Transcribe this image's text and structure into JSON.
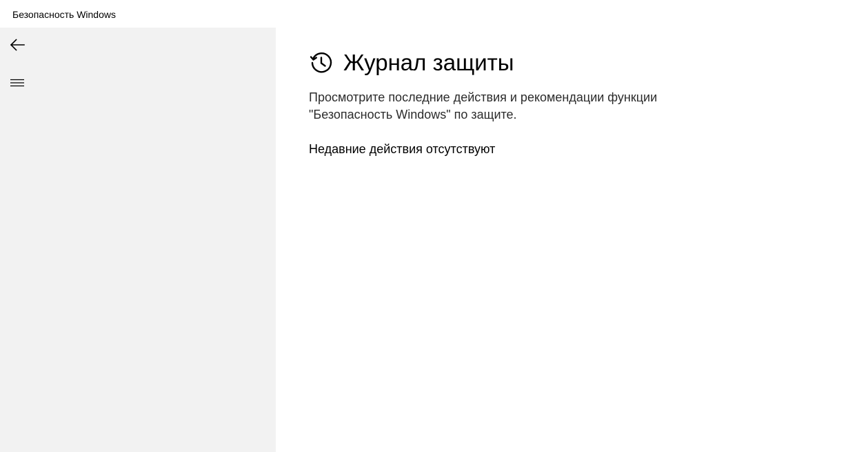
{
  "window": {
    "title": "Безопасность Windows"
  },
  "sidebar": {
    "back_icon": "arrow-left-icon",
    "menu_icon": "hamburger-menu-icon",
    "background_color": "#f2f2f2"
  },
  "main": {
    "heading_icon": "history-clock-icon",
    "title": "Журнал защиты",
    "description": "Просмотрите последние действия и рекомендации функции \"Безопасность Windows\" по защите.",
    "status": "Недавние действия отсутствуют"
  }
}
